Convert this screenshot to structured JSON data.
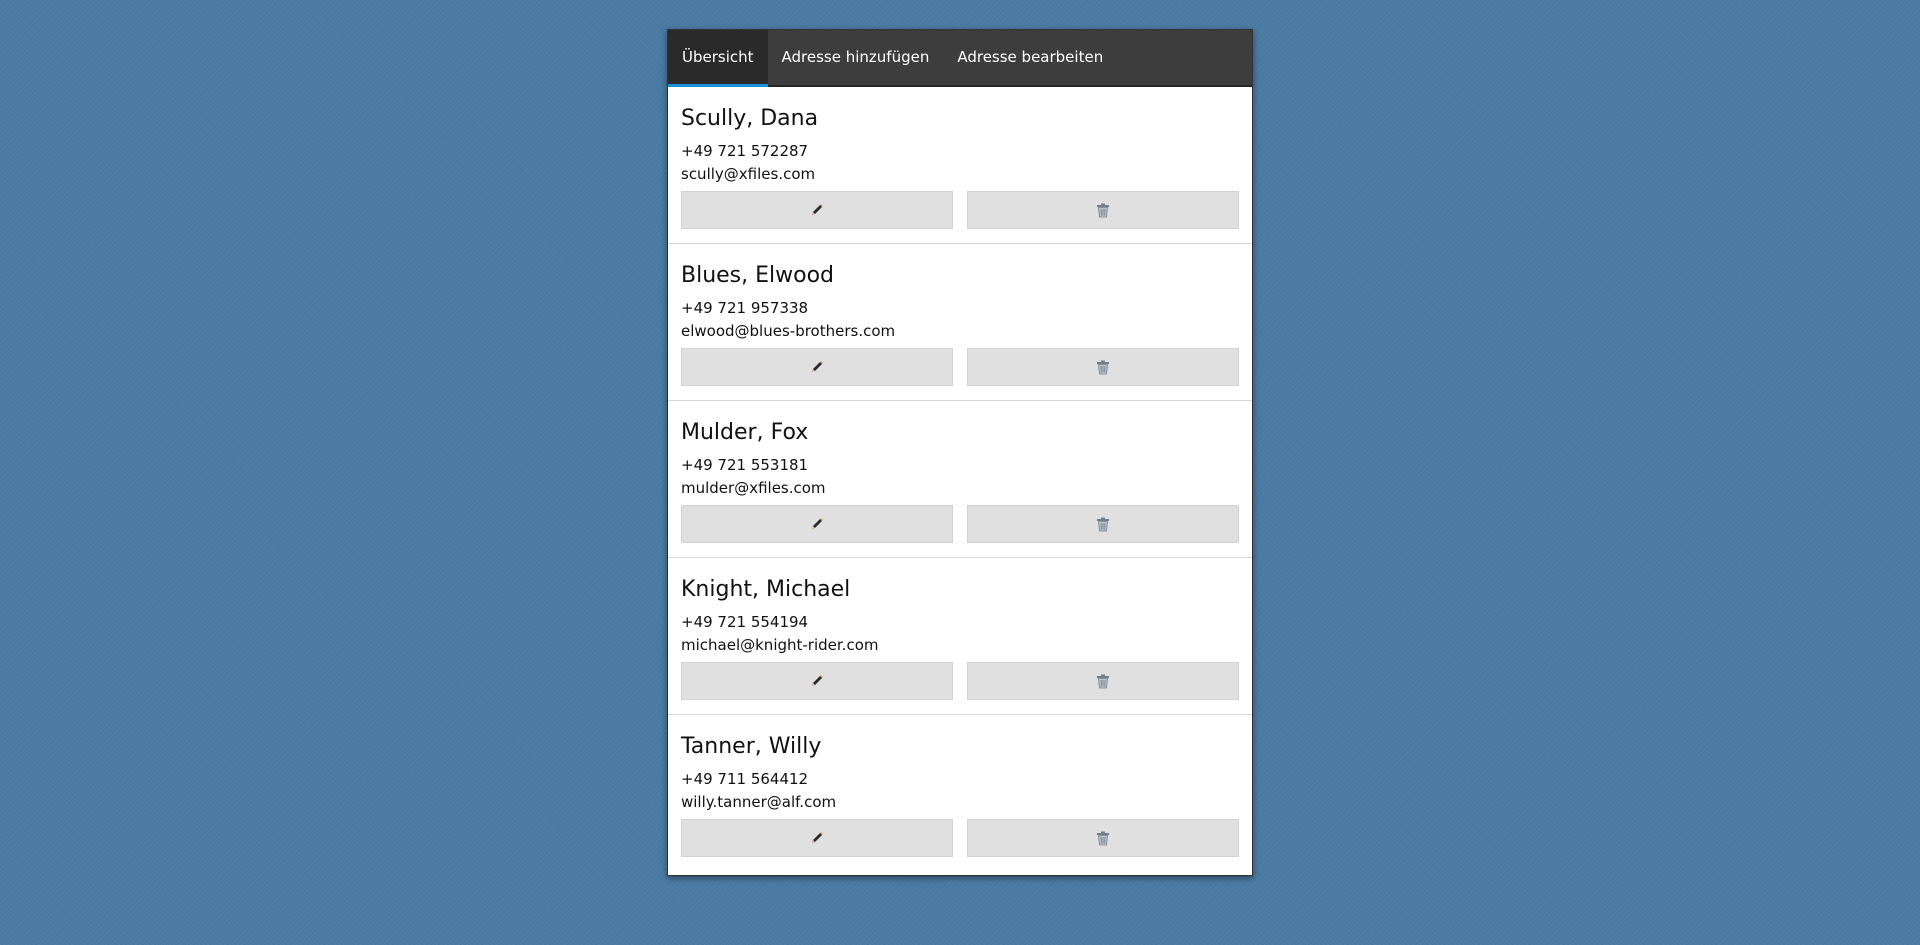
{
  "tabs": [
    {
      "label": "Übersicht",
      "active": true
    },
    {
      "label": "Adresse hinzufügen",
      "active": false
    },
    {
      "label": "Adresse bearbeiten",
      "active": false
    }
  ],
  "contacts": [
    {
      "name": "Scully, Dana",
      "phone": "+49 721 572287",
      "email": "scully@xfiles.com",
      "edit_icon": "pencil-icon",
      "delete_icon": "trash-icon"
    },
    {
      "name": "Blues, Elwood",
      "phone": "+49 721 957338",
      "email": "elwood@blues-brothers.com",
      "edit_icon": "pencil-icon",
      "delete_icon": "trash-icon"
    },
    {
      "name": "Mulder, Fox",
      "phone": "+49 721 553181",
      "email": "mulder@xfiles.com",
      "edit_icon": "pencil-icon",
      "delete_icon": "trash-icon"
    },
    {
      "name": "Knight, Michael",
      "phone": "+49 721 554194",
      "email": "michael@knight-rider.com",
      "edit_icon": "pencil-icon",
      "delete_icon": "trash-icon"
    },
    {
      "name": "Tanner, Willy",
      "phone": "+49 711 564412",
      "email": "willy.tanner@alf.com",
      "edit_icon": "pencil-icon",
      "delete_icon": "trash-icon"
    }
  ],
  "colors": {
    "background": "#4a7aa3",
    "tabbar": "#3d3d3d",
    "tab_active_indicator": "#1d8fd6",
    "button": "#e0e0e0"
  }
}
